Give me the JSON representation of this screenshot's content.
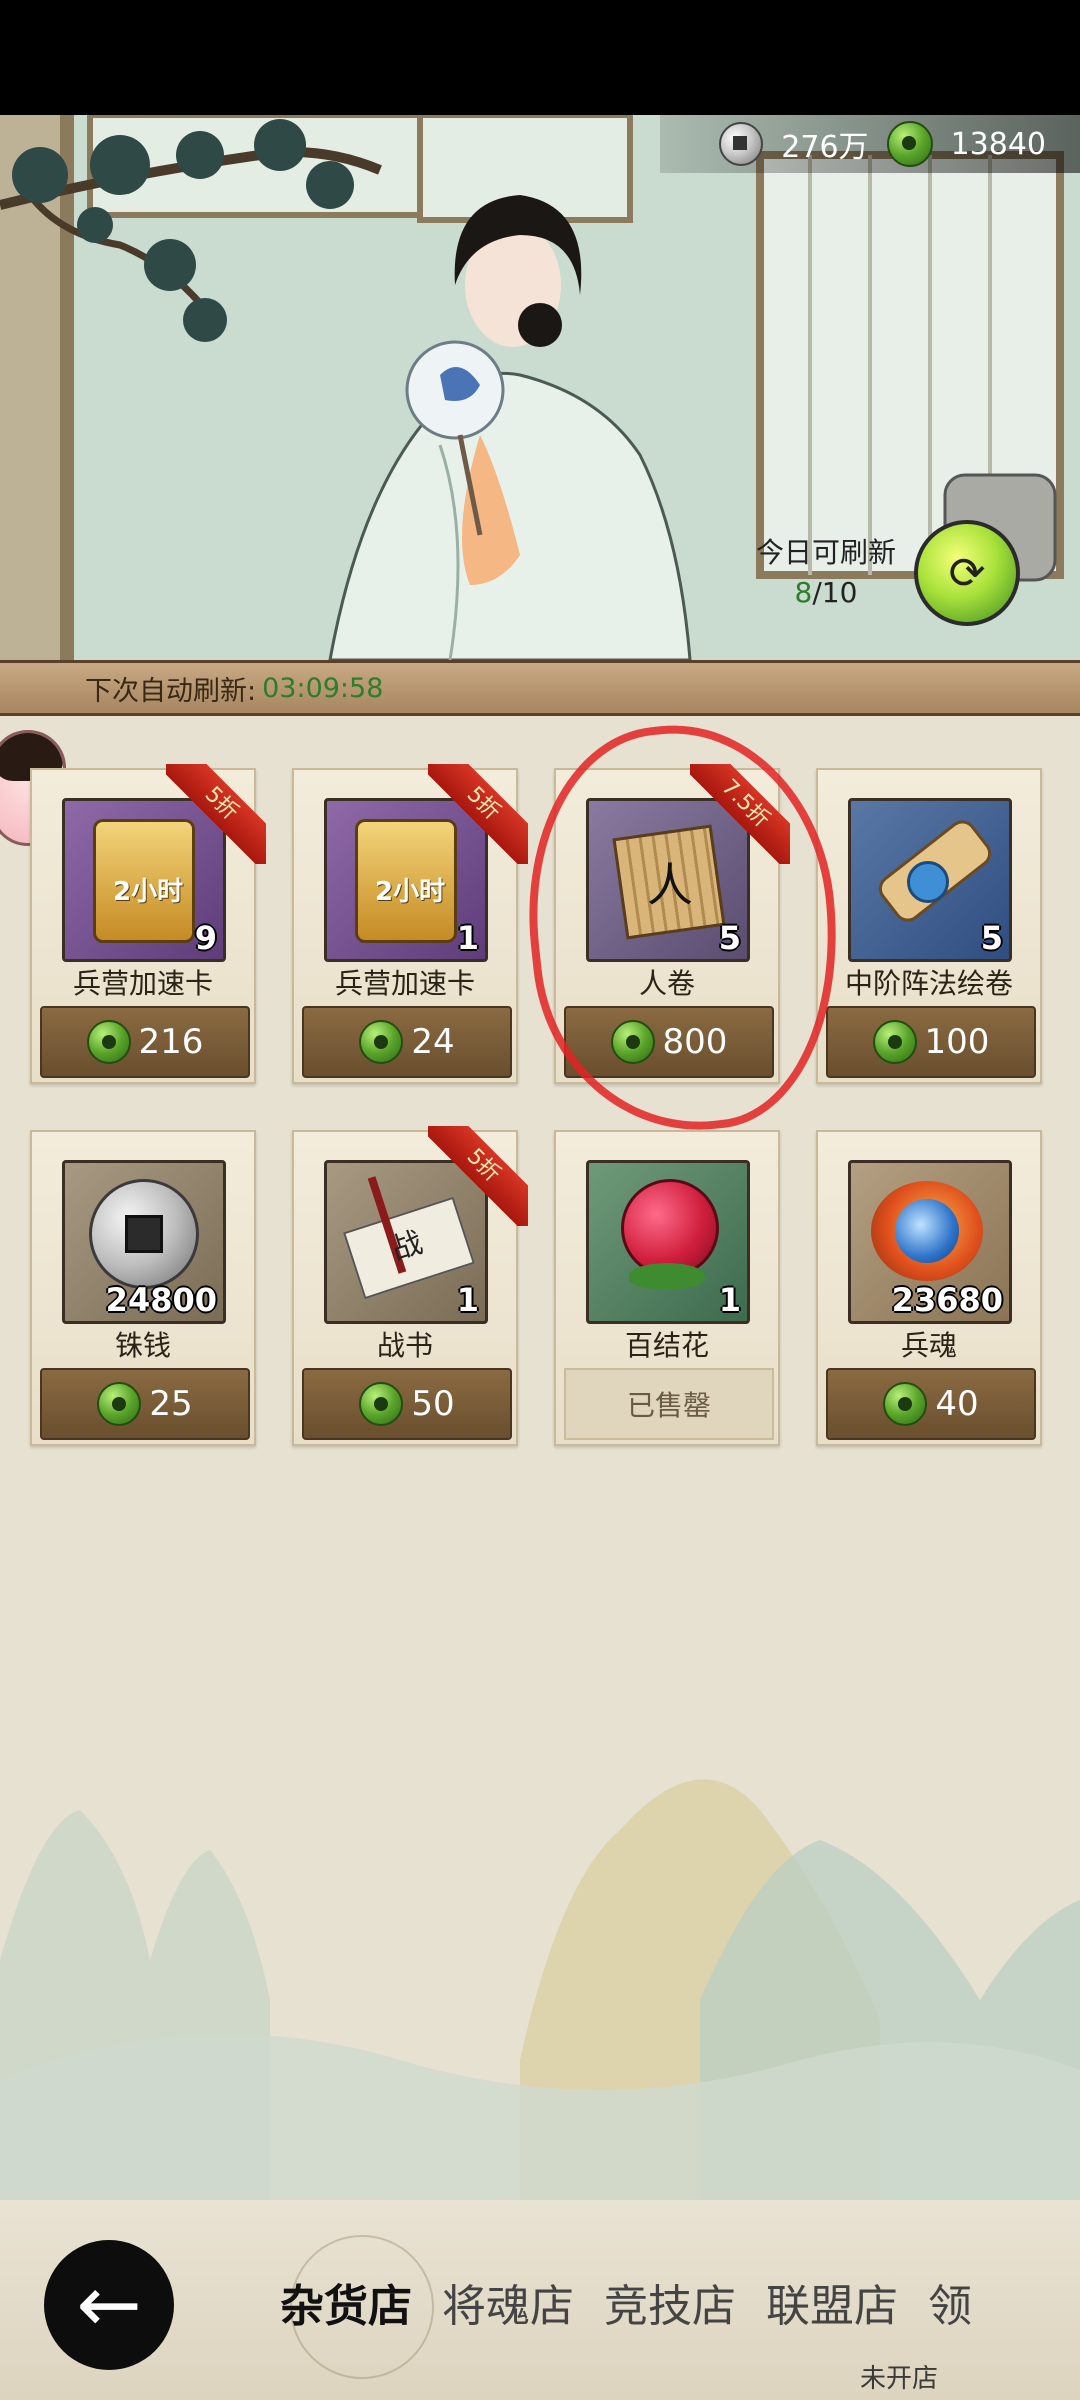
{
  "currency": {
    "coins": "276万",
    "jade": "13840"
  },
  "refresh": {
    "label": "今日可刷新",
    "current": "8",
    "total": "/10"
  },
  "auto_refresh": {
    "label": "下次自动刷新:",
    "time": "03:09:58"
  },
  "items": [
    {
      "name": "兵营加速卡",
      "qty": "9",
      "price": "216",
      "badge": "5折",
      "icon": "speedup-card-icon",
      "art": "2小时"
    },
    {
      "name": "兵营加速卡",
      "qty": "1",
      "price": "24",
      "badge": "5折",
      "icon": "speedup-card-icon",
      "art": "2小时"
    },
    {
      "name": "人卷",
      "qty": "5",
      "price": "800",
      "badge": "7.5折",
      "icon": "scroll-icon",
      "art": "人"
    },
    {
      "name": "中阶阵法绘卷",
      "qty": "5",
      "price": "100",
      "badge": "",
      "icon": "formation-scroll-icon",
      "art": ""
    },
    {
      "name": "铢钱",
      "qty": "24800",
      "price": "25",
      "badge": "",
      "icon": "coin-icon",
      "art": ""
    },
    {
      "name": "战书",
      "qty": "1",
      "price": "50",
      "badge": "5折",
      "icon": "war-letter-icon",
      "art": "战"
    },
    {
      "name": "百结花",
      "qty": "1",
      "price": "",
      "sold": "已售罄",
      "badge": "",
      "icon": "raspberry-flower-icon",
      "art": ""
    },
    {
      "name": "兵魂",
      "qty": "23680",
      "price": "40",
      "badge": "",
      "icon": "soldier-soul-icon",
      "art": ""
    }
  ],
  "tabs": [
    "杂货店",
    "将魂店",
    "竞技店",
    "联盟店",
    "领"
  ],
  "tab_note": "未开店",
  "colors": {
    "accent_green": "#2d7d2a",
    "price_brown": "#7a5c38",
    "badge_red": "#c62a1c",
    "mark_red": "#e22323"
  }
}
